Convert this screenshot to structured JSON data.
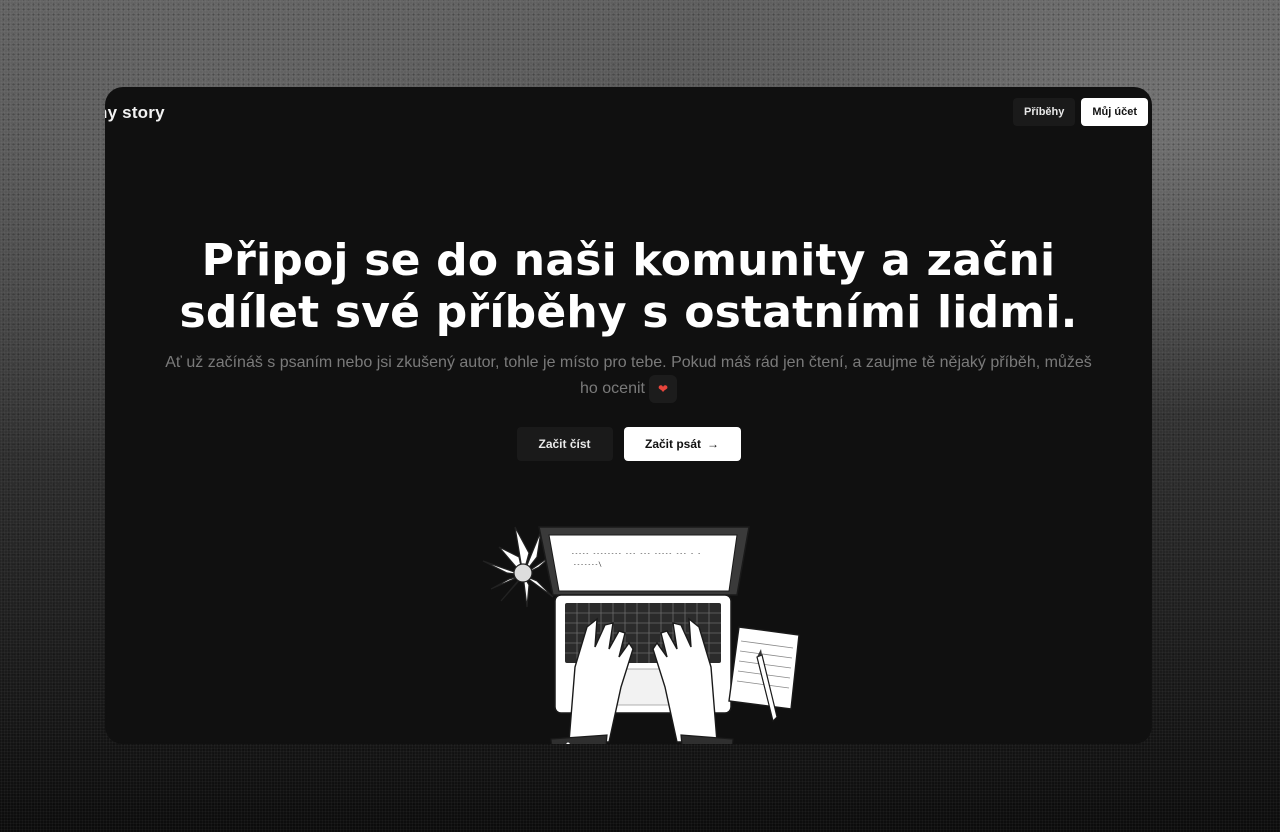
{
  "header": {
    "logo_text": "ny story",
    "nav": [
      {
        "label": "Příběhy"
      },
      {
        "label": "Můj účet"
      }
    ]
  },
  "hero": {
    "title": "Připoj se do naši komunity a začni sdílet své příběhy s ostatními lidmi.",
    "subtitle": "Ať už začínáš s psaním nebo jsi zkušený autor, tohle je místo pro tebe. Pokud máš rád jen čtení, a zaujme tě nějaký příběh, můžeš ho ocenit",
    "heart_icon": "heart-icon",
    "cta": {
      "read_label": "Začit číst",
      "write_label": "Začit psát",
      "write_icon": "arrow-right-icon"
    }
  },
  "illustration": {
    "screen_line_1": "----- -------- --- ---   ----- --- - -",
    "screen_line_2": "-------\\"
  },
  "colors": {
    "window_bg": "#101010",
    "heart": "#e8453c",
    "primary_button": "#ffffff",
    "secondary_button": "#1a1a1a"
  }
}
